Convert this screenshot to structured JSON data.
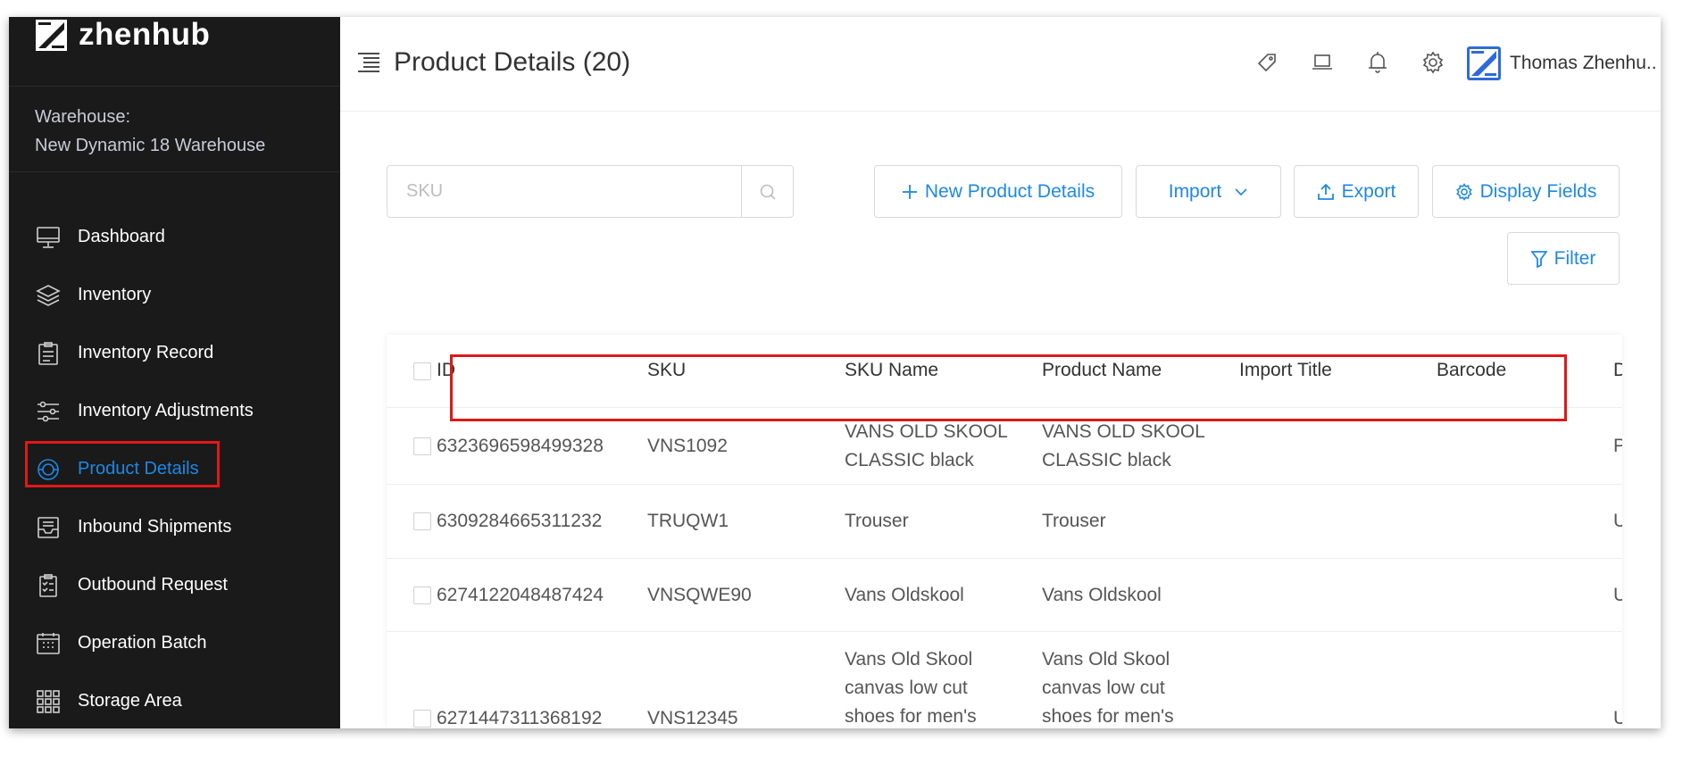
{
  "app": {
    "name": "zhenhub"
  },
  "sidebar": {
    "warehouse_label": "Warehouse:",
    "warehouse_name": "New Dynamic 18 Warehouse",
    "items": [
      {
        "label": "Dashboard",
        "icon": "monitor-icon"
      },
      {
        "label": "Inventory",
        "icon": "layers-icon"
      },
      {
        "label": "Inventory Record",
        "icon": "clipboard-icon"
      },
      {
        "label": "Inventory Adjustments",
        "icon": "sliders-icon"
      },
      {
        "label": "Product Details",
        "icon": "product-circle-icon",
        "active": true
      },
      {
        "label": "Inbound Shipments",
        "icon": "inbox-icon"
      },
      {
        "label": "Outbound Request",
        "icon": "checklist-icon"
      },
      {
        "label": "Operation Batch",
        "icon": "calendar-grid-icon"
      },
      {
        "label": "Storage Area",
        "icon": "grid-icon"
      }
    ]
  },
  "header": {
    "title": "Product Details (20)",
    "user_name": "Thomas Zhenhu.."
  },
  "toolbar": {
    "search_placeholder": "SKU",
    "new_label": "New Product Details",
    "import_label": "Import",
    "export_label": "Export",
    "display_fields_label": "Display Fields",
    "filter_label": "Filter"
  },
  "table": {
    "columns": [
      "ID",
      "SKU",
      "SKU Name",
      "Product Name",
      "Import Title",
      "Barcode",
      "D"
    ],
    "rows": [
      {
        "id": "6323696598499328",
        "sku": "VNS1092",
        "sku_name": "VANS OLD SKOOL CLASSIC black",
        "product_name": "VANS OLD SKOOL CLASSIC black",
        "import_title": "",
        "barcode": "",
        "d": "Pl"
      },
      {
        "id": "6309284665311232",
        "sku": "TRUQW1",
        "sku_name": "Trouser",
        "product_name": "Trouser",
        "import_title": "",
        "barcode": "",
        "d": "U"
      },
      {
        "id": "6274122048487424",
        "sku": "VNSQWE90",
        "sku_name": "Vans Oldskool",
        "product_name": "Vans Oldskool",
        "import_title": "",
        "barcode": "",
        "d": "U"
      },
      {
        "id": "6271447311368192",
        "sku": "VNS12345",
        "sku_name": "Vans Old Skool canvas low cut shoes for men's",
        "product_name": "Vans Old Skool canvas low cut shoes for men's",
        "import_title": "",
        "barcode": "",
        "d": "U"
      }
    ]
  },
  "colors": {
    "accent": "#1e88e5",
    "sidebar_bg": "#1a1a1a",
    "highlight": "#e01818"
  }
}
